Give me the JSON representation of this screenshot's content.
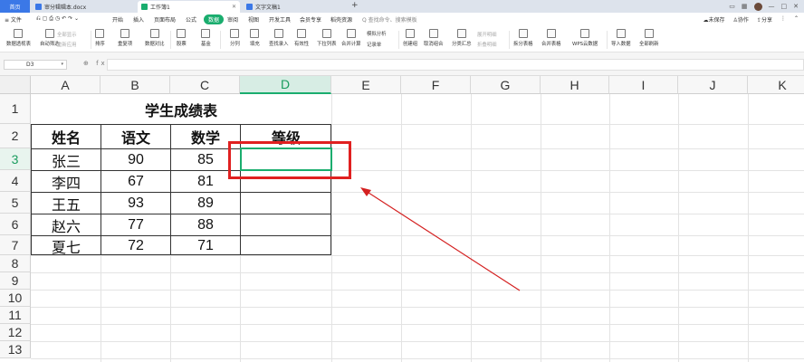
{
  "tabs": {
    "home": "首页",
    "doc": "审分辑辑本.docx",
    "active": "工作簿1",
    "text": "文字文稿1",
    "plus": "+"
  },
  "window": {
    "save": "未保存",
    "collab": "协作",
    "share": "分享"
  },
  "menu": {
    "file": "≡ 文件",
    "items": [
      "开始",
      "插入",
      "页面布局",
      "公式",
      "数据",
      "审阅",
      "视图",
      "开发工具",
      "会员专享",
      "稻壳资源"
    ],
    "active_index": 4,
    "search": "Q 查找命令、搜索模板"
  },
  "toolbar": {
    "buttons": [
      "数据透视表",
      "自动筛选",
      "排序",
      "重复项",
      "数据对比",
      "股票",
      "基金",
      "分列",
      "填充",
      "查找录入",
      "有效性",
      "下拉列表",
      "合并计算",
      "模拟分析",
      "记录单",
      "创建组",
      "取消组合",
      "分类汇总",
      "拆分表格",
      "合并表格",
      "WPS云数据",
      "导入数据",
      "全部刷新"
    ],
    "small": [
      "全部显示",
      "重新应用",
      "展开明细",
      "折叠明细"
    ]
  },
  "formula_bar": {
    "cell_ref": "D3",
    "fx": "⊕ fx",
    "value": ""
  },
  "columns": [
    "A",
    "B",
    "C",
    "D",
    "E",
    "F",
    "G",
    "H",
    "I",
    "J",
    "K"
  ],
  "selected_column": "D",
  "rows": [
    "1",
    "2",
    "3",
    "4",
    "5",
    "6",
    "7",
    "8",
    "9",
    "10",
    "11",
    "12",
    "13"
  ],
  "selected_row": "3",
  "sheet": {
    "title": "学生成绩表",
    "headers": [
      "姓名",
      "语文",
      "数学",
      "等级"
    ],
    "data": [
      [
        "张三",
        "90",
        "85",
        ""
      ],
      [
        "李四",
        "67",
        "81",
        ""
      ],
      [
        "王五",
        "93",
        "89",
        ""
      ],
      [
        "赵六",
        "77",
        "88",
        ""
      ],
      [
        "夏七",
        "72",
        "71",
        ""
      ]
    ]
  },
  "colors": {
    "accent": "#1aad6e",
    "annotation": "#e02020",
    "tab_home": "#3b78e7"
  }
}
